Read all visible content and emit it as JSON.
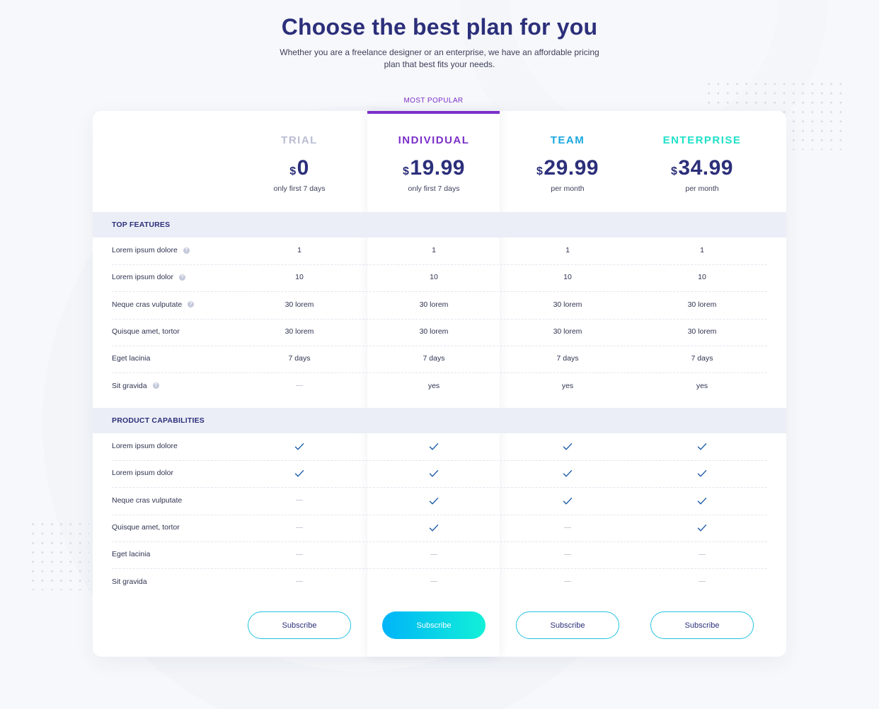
{
  "header": {
    "title": "Choose the best plan for you",
    "subtitle": "Whether you are a freelance designer or an enterprise, we have an affordable pricing plan that best fits your needs."
  },
  "popular_label": "MOST POPULAR",
  "plans": [
    {
      "name": "TRIAL",
      "currency": "$",
      "price": "0",
      "note": "only first 7 days",
      "color": "#b9bdd1",
      "button": "Subscribe"
    },
    {
      "name": "INDIVIDUAL",
      "currency": "$",
      "price": "19.99",
      "note": "only first 7 days",
      "color": "#7b2fc8",
      "button": "Subscribe"
    },
    {
      "name": "TEAM",
      "currency": "$",
      "price": "29.99",
      "note": "per month",
      "color": "#1aa8e0",
      "button": "Subscribe"
    },
    {
      "name": "ENTERPRISE",
      "currency": "$",
      "price": "34.99",
      "note": "per month",
      "color": "#1fe0c8",
      "button": "Subscribe"
    }
  ],
  "sections": [
    {
      "title": "TOP FEATURES",
      "rows": [
        {
          "label": "Lorem ipsum dolore",
          "help": true,
          "values": [
            "1",
            "1",
            "1",
            "1"
          ]
        },
        {
          "label": "Lorem ipsum dolor",
          "help": true,
          "values": [
            "10",
            "10",
            "10",
            "10"
          ]
        },
        {
          "label": "Neque cras vulputate",
          "help": true,
          "values": [
            "30 lorem",
            "30 lorem",
            "30 lorem",
            "30 lorem"
          ]
        },
        {
          "label": "Quisque amet, tortor",
          "help": false,
          "values": [
            "30 lorem",
            "30 lorem",
            "30 lorem",
            "30 lorem"
          ]
        },
        {
          "label": "Eget lacinia",
          "help": false,
          "values": [
            "7 days",
            "7 days",
            "7 days",
            "7 days"
          ]
        },
        {
          "label": "Sit gravida",
          "help": true,
          "values": [
            "-",
            "yes",
            "yes",
            "yes"
          ]
        }
      ]
    },
    {
      "title": "PRODUCT CAPABILITIES",
      "rows": [
        {
          "label": "Lorem ipsum dolore",
          "help": false,
          "values": [
            "check",
            "check",
            "check",
            "check"
          ]
        },
        {
          "label": "Lorem ipsum dolor",
          "help": false,
          "values": [
            "check",
            "check",
            "check",
            "check"
          ]
        },
        {
          "label": "Neque cras vulputate",
          "help": false,
          "values": [
            "-",
            "check",
            "check",
            "check"
          ]
        },
        {
          "label": "Quisque amet, tortor",
          "help": false,
          "values": [
            "-",
            "check",
            "-",
            "check"
          ]
        },
        {
          "label": "Eget lacinia",
          "help": false,
          "values": [
            "-",
            "-",
            "-",
            "-"
          ]
        },
        {
          "label": "Sit gravida",
          "help": false,
          "values": [
            "-",
            "-",
            "-",
            "-"
          ]
        }
      ]
    }
  ],
  "colors": {
    "accent_purple": "#7b2fc8",
    "check": "#1b5aa8",
    "button_gradient_start": "#00b4f8",
    "button_gradient_end": "#12f0d8"
  },
  "icons": {
    "help": "question-circle-icon",
    "check": "check-icon",
    "dash": "dash-icon"
  }
}
